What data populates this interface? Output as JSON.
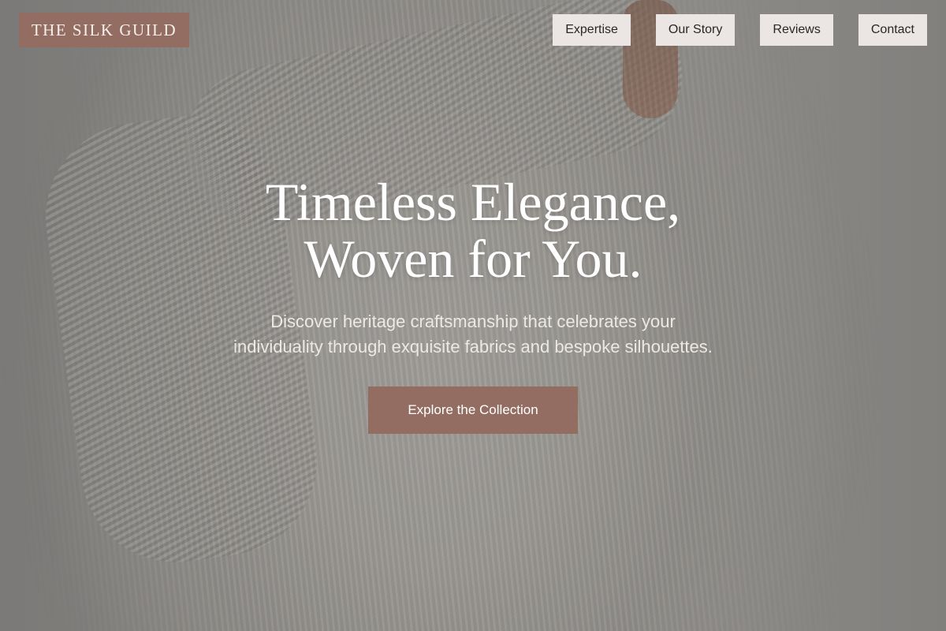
{
  "hero_image": {
    "icon": "knit-sweater-photo"
  },
  "brand": {
    "name": "THE SILK GUILD"
  },
  "nav": {
    "items": [
      {
        "label": "Expertise"
      },
      {
        "label": "Our Story"
      },
      {
        "label": "Reviews"
      },
      {
        "label": "Contact"
      }
    ]
  },
  "hero": {
    "title_line1": "Timeless Elegance,",
    "title_line2": "Woven for You.",
    "subtitle": "Discover heritage craftsmanship that celebrates your individuality through exquisite fabrics and bespoke silhouettes.",
    "cta_label": "Explore the Collection"
  },
  "colors": {
    "accent": "#946d62",
    "nav_bg": "#ebe6e3",
    "nav_text": "#2b2624",
    "hero_text": "#ffffff"
  }
}
